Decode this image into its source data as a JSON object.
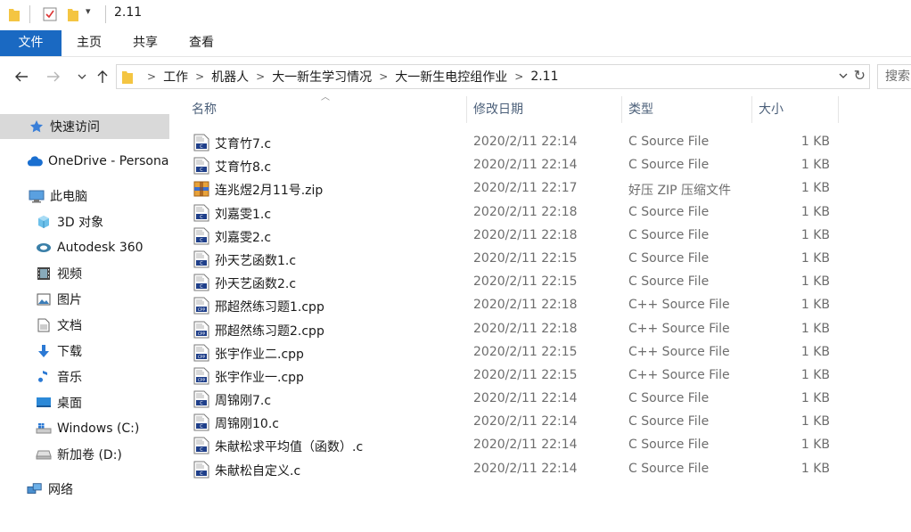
{
  "window": {
    "title": "2.11"
  },
  "ribbon": {
    "tabs": [
      {
        "label": "文件"
      },
      {
        "label": "主页"
      },
      {
        "label": "共享"
      },
      {
        "label": "查看"
      }
    ]
  },
  "address": {
    "crumbs": [
      "工作",
      "机器人",
      "大一新生学习情况",
      "大一新生电控组作业",
      "2.11"
    ],
    "search_placeholder": "搜索"
  },
  "sidebar": {
    "items": [
      {
        "label": "快速访问",
        "icon": "star-icon"
      },
      {
        "label": "OneDrive - Persona",
        "icon": "cloud-icon"
      },
      {
        "label": "此电脑",
        "icon": "computer-icon"
      },
      {
        "label": "3D 对象",
        "icon": "cube-icon"
      },
      {
        "label": "Autodesk 360",
        "icon": "autodesk-icon"
      },
      {
        "label": "视频",
        "icon": "video-icon"
      },
      {
        "label": "图片",
        "icon": "picture-icon"
      },
      {
        "label": "文档",
        "icon": "document-icon"
      },
      {
        "label": "下载",
        "icon": "download-icon"
      },
      {
        "label": "音乐",
        "icon": "music-icon"
      },
      {
        "label": "桌面",
        "icon": "desktop-icon"
      },
      {
        "label": "Windows (C:)",
        "icon": "windows-drive-icon"
      },
      {
        "label": "新加卷 (D:)",
        "icon": "drive-icon"
      },
      {
        "label": "网络",
        "icon": "network-icon"
      }
    ]
  },
  "columns": {
    "name": "名称",
    "date": "修改日期",
    "type": "类型",
    "size": "大小"
  },
  "files": [
    {
      "name": "艾育竹7.c",
      "date": "2020/2/11 22:14",
      "type": "C Source File",
      "size": "1 KB",
      "icon": "c-file-icon"
    },
    {
      "name": "艾育竹8.c",
      "date": "2020/2/11 22:14",
      "type": "C Source File",
      "size": "1 KB",
      "icon": "c-file-icon"
    },
    {
      "name": "连兆煜2月11号.zip",
      "date": "2020/2/11 22:17",
      "type": "好压 ZIP 压缩文件",
      "size": "1 KB",
      "icon": "zip-file-icon"
    },
    {
      "name": "刘嘉雯1.c",
      "date": "2020/2/11 22:18",
      "type": "C Source File",
      "size": "1 KB",
      "icon": "c-file-icon"
    },
    {
      "name": "刘嘉雯2.c",
      "date": "2020/2/11 22:18",
      "type": "C Source File",
      "size": "1 KB",
      "icon": "c-file-icon"
    },
    {
      "name": "孙天艺函数1.c",
      "date": "2020/2/11 22:15",
      "type": "C Source File",
      "size": "1 KB",
      "icon": "c-file-icon"
    },
    {
      "name": "孙天艺函数2.c",
      "date": "2020/2/11 22:15",
      "type": "C Source File",
      "size": "1 KB",
      "icon": "c-file-icon"
    },
    {
      "name": "邢超然练习题1.cpp",
      "date": "2020/2/11 22:18",
      "type": "C++ Source File",
      "size": "1 KB",
      "icon": "cpp-file-icon"
    },
    {
      "name": "邢超然练习题2.cpp",
      "date": "2020/2/11 22:18",
      "type": "C++ Source File",
      "size": "1 KB",
      "icon": "cpp-file-icon"
    },
    {
      "name": "张宇作业二.cpp",
      "date": "2020/2/11 22:15",
      "type": "C++ Source File",
      "size": "1 KB",
      "icon": "cpp-file-icon"
    },
    {
      "name": "张宇作业一.cpp",
      "date": "2020/2/11 22:15",
      "type": "C++ Source File",
      "size": "1 KB",
      "icon": "cpp-file-icon"
    },
    {
      "name": "周锦刚7.c",
      "date": "2020/2/11 22:14",
      "type": "C Source File",
      "size": "1 KB",
      "icon": "c-file-icon"
    },
    {
      "name": "周锦刚10.c",
      "date": "2020/2/11 22:14",
      "type": "C Source File",
      "size": "1 KB",
      "icon": "c-file-icon"
    },
    {
      "name": "朱献松求平均值（函数）.c",
      "date": "2020/2/11 22:14",
      "type": "C Source File",
      "size": "1 KB",
      "icon": "c-file-icon"
    },
    {
      "name": "朱献松自定义.c",
      "date": "2020/2/11 22:14",
      "type": "C Source File",
      "size": "1 KB",
      "icon": "c-file-icon"
    }
  ],
  "colors": {
    "accent": "#1a69c2",
    "folder": "#f4c542",
    "header_text": "#4c607a",
    "selected_bg": "#d9d9d9"
  }
}
